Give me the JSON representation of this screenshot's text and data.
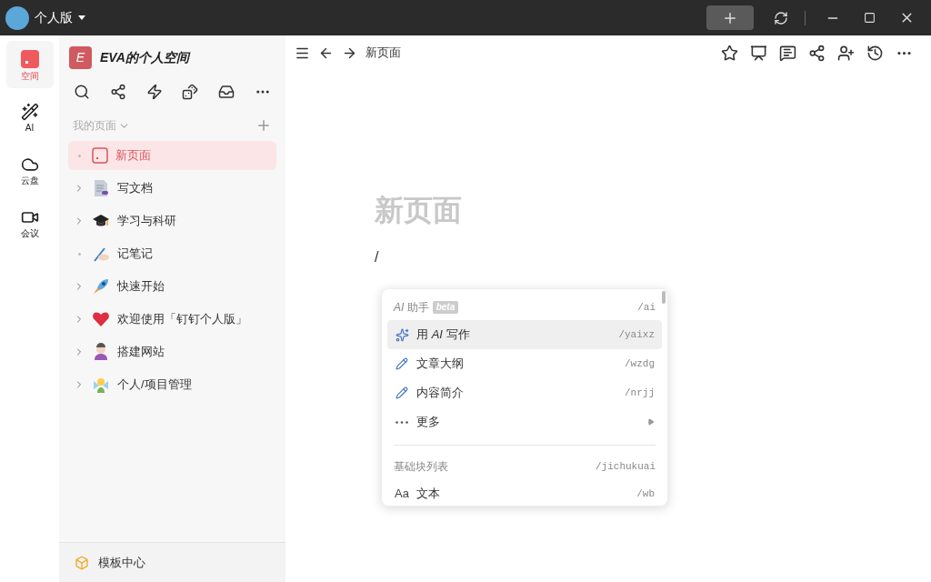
{
  "titlebar": {
    "account": "个人版"
  },
  "rail": [
    {
      "label": "空间",
      "selected": true
    },
    {
      "label": "AI",
      "selected": false
    },
    {
      "label": "云盘",
      "selected": false
    },
    {
      "label": "会议",
      "selected": false
    }
  ],
  "sidebar": {
    "space_initial": "E",
    "space_name": "EVA的个人空间",
    "section": "我的页面",
    "pages": [
      {
        "label": "新页面",
        "kind": "page",
        "selected": true
      },
      {
        "label": "写文档",
        "kind": "folder",
        "selected": false
      },
      {
        "label": "学习与科研",
        "kind": "folder",
        "selected": false
      },
      {
        "label": "记笔记",
        "kind": "page",
        "selected": false
      },
      {
        "label": "快速开始",
        "kind": "folder",
        "selected": false
      },
      {
        "label": "欢迎使用「钉钉个人版」",
        "kind": "folder",
        "selected": false
      },
      {
        "label": "搭建网站",
        "kind": "folder",
        "selected": false
      },
      {
        "label": "个人/项目管理",
        "kind": "folder",
        "selected": false
      }
    ],
    "footer": "模板中心"
  },
  "breadcrumb": "新页面",
  "editor": {
    "title": "新页面",
    "typed": "/"
  },
  "menu": {
    "sections": [
      {
        "title": "*AI* 助手",
        "badge": "beta",
        "shortcut": "/ai",
        "items": [
          {
            "label": "用 *AI* 写作",
            "shortcut": "/yaixz",
            "kind": "ai",
            "selected": true
          },
          {
            "label": "文章大纲",
            "shortcut": "/wzdg",
            "kind": "pen",
            "selected": false
          },
          {
            "label": "内容简介",
            "shortcut": "/nrjj",
            "kind": "pen",
            "selected": false
          },
          {
            "label": "更多",
            "kind": "submenu",
            "selected": false
          }
        ]
      },
      {
        "title": "基础块列表",
        "shortcut": "/jichukuai",
        "items": [
          {
            "label": "文本",
            "icon_text": "Aa",
            "shortcut": "/wb",
            "kind": "text",
            "selected": false
          }
        ]
      }
    ]
  }
}
